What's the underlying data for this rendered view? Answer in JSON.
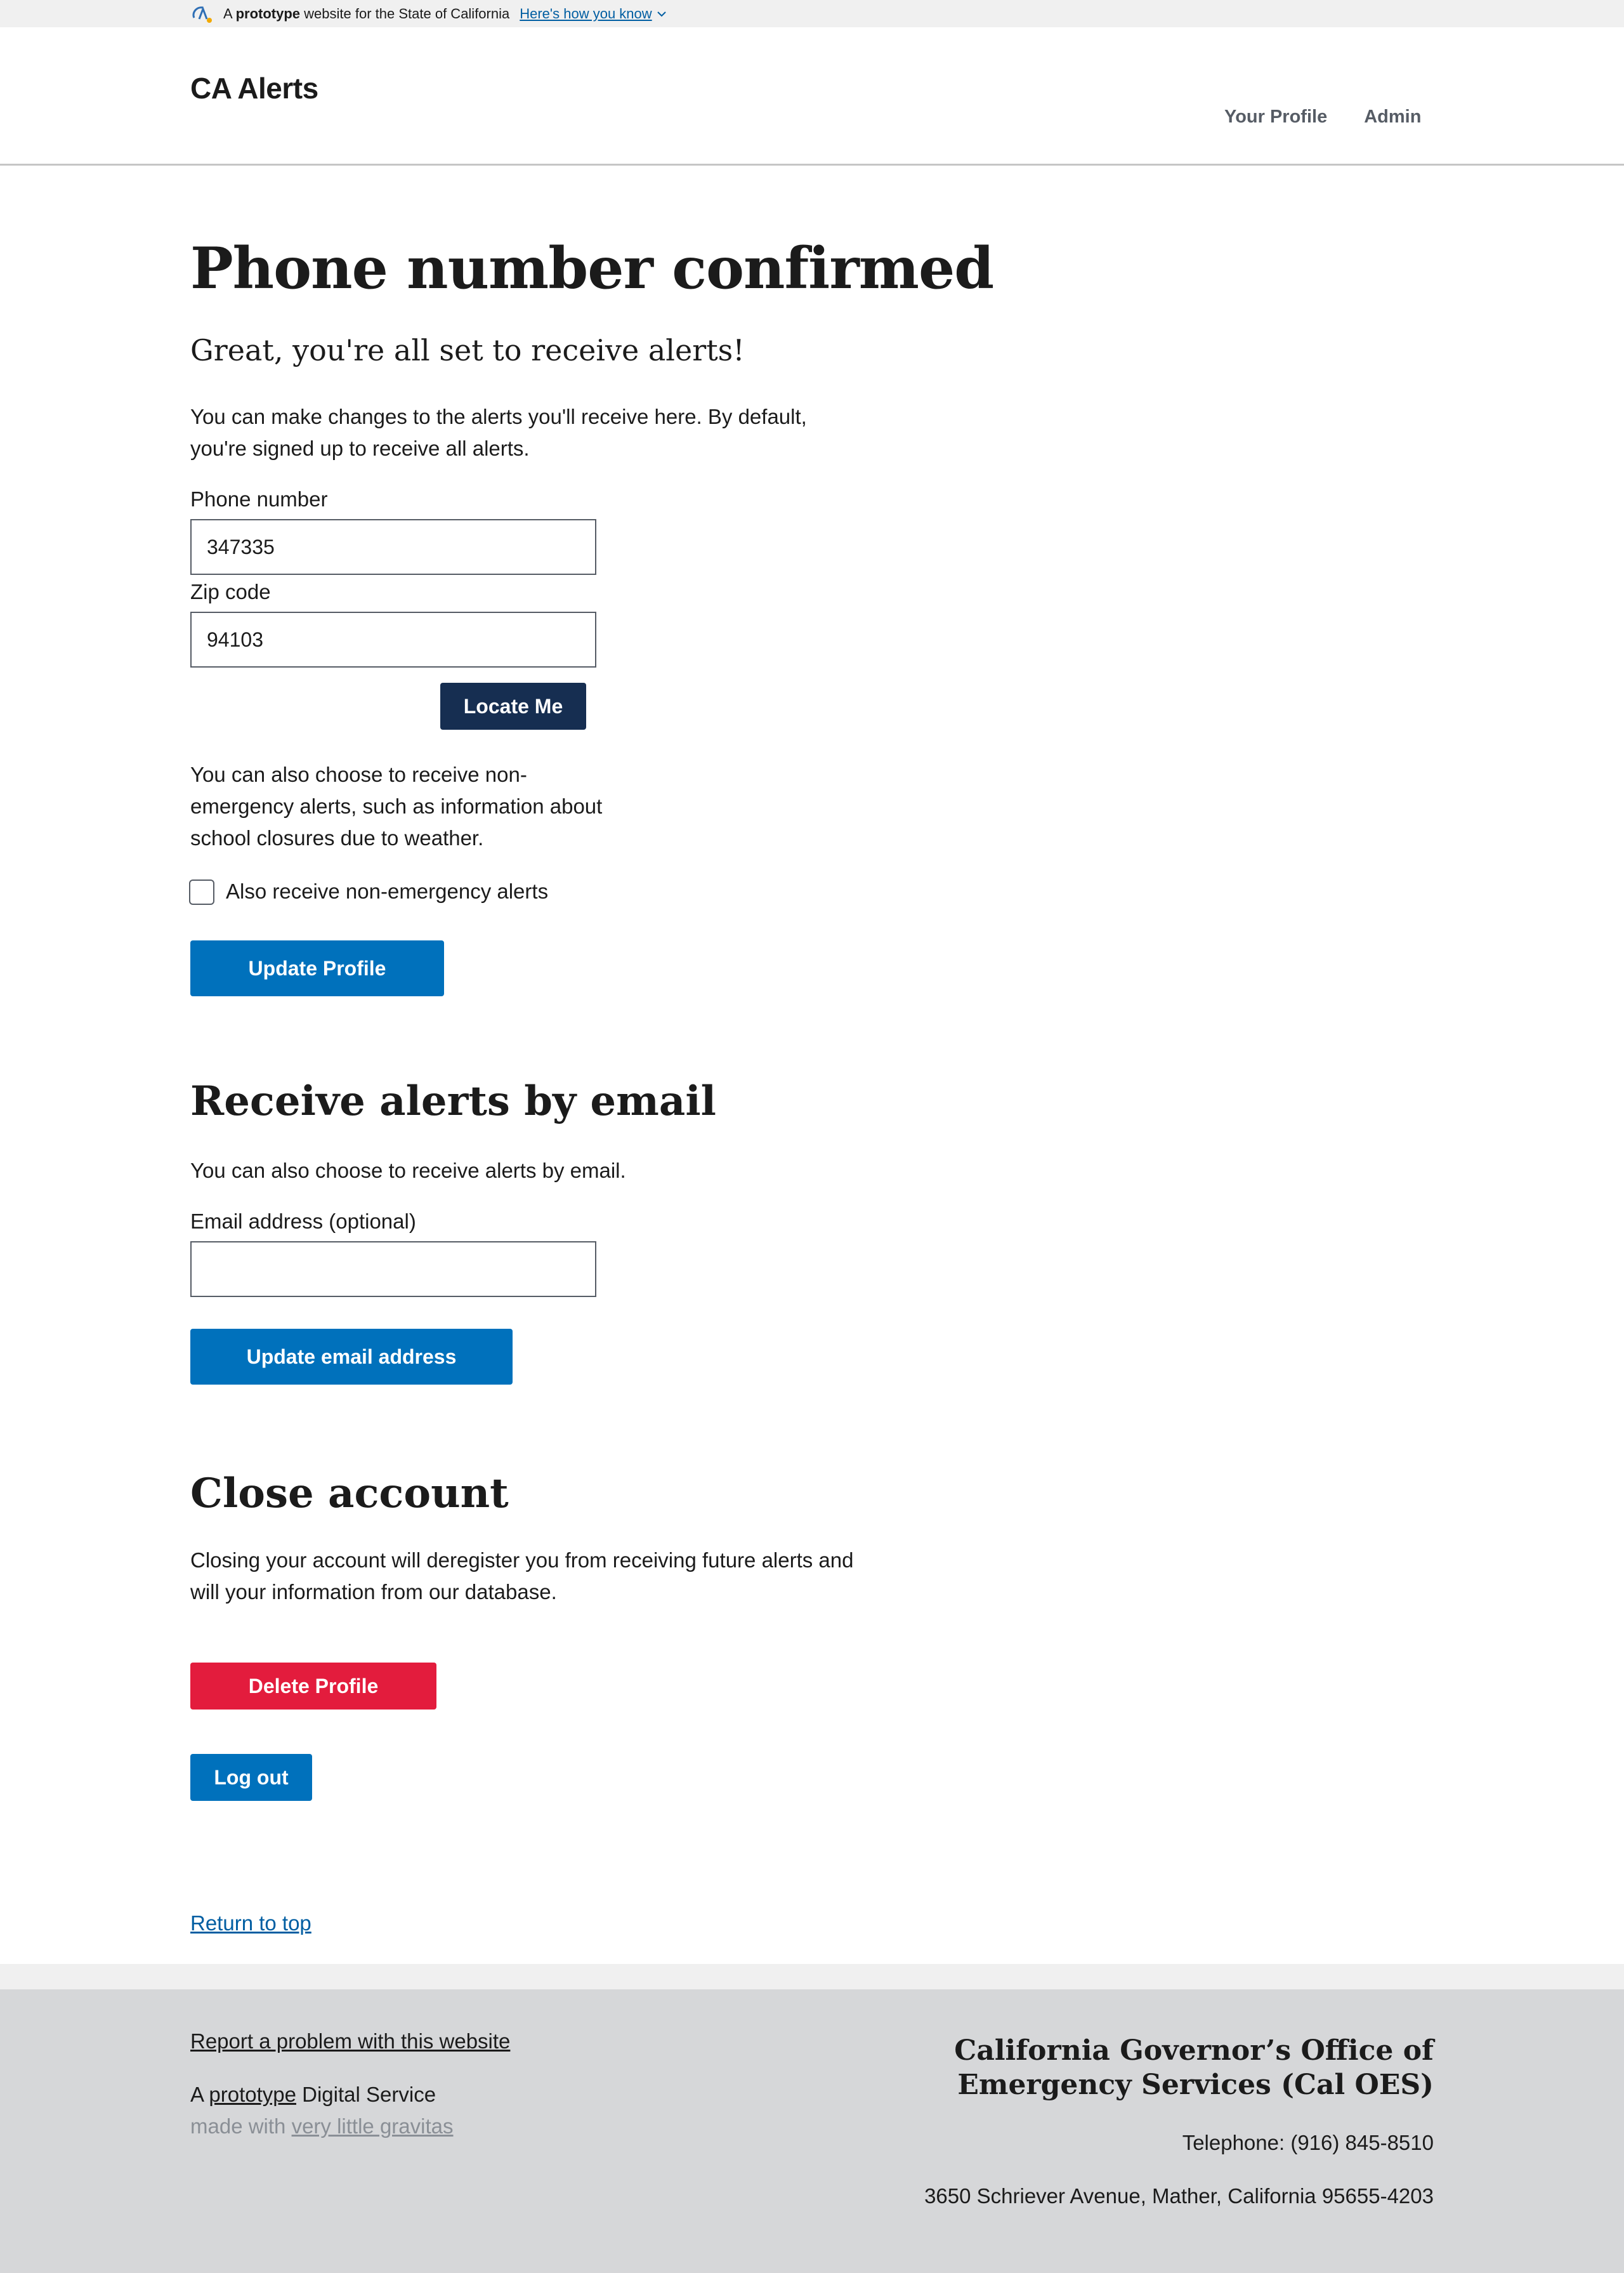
{
  "banner": {
    "prefix": "A",
    "bold": "prototype",
    "suffix": "website for the State of California",
    "link": "Here's how you know"
  },
  "header": {
    "title": "CA Alerts",
    "nav": [
      "Your Profile",
      "Admin"
    ]
  },
  "main": {
    "title": "Phone number confirmed",
    "lead": "Great, you're all set to receive alerts!",
    "intro": "You can make changes to the alerts you'll receive here. By default, you're signed up to receive all alerts.",
    "phone_label": "Phone number",
    "phone_value": "347335",
    "zip_label": "Zip code",
    "zip_value": "94103",
    "locate_button": "Locate Me",
    "nonemergency_text": "You can also choose to receive non-emergency alerts, such as information about school closures due to weather.",
    "nonemergency_checkbox_label": "Also receive non-emergency alerts",
    "nonemergency_checked": false,
    "update_profile_button": "Update Profile"
  },
  "email_section": {
    "title": "Receive alerts by email",
    "text": "You can also choose to receive alerts by email.",
    "email_label": "Email address (optional)",
    "email_value": "",
    "update_email_button": "Update email address"
  },
  "close_section": {
    "title": "Close account",
    "text": "Closing your account will deregister you from receiving future alerts and will your information from our database.",
    "delete_button": "Delete Profile",
    "logout_button": "Log out"
  },
  "return_to_top": "Return to top",
  "footer": {
    "report_link": "Report a problem with this website",
    "digital_service_prefix": "A",
    "digital_service_link": "prototype",
    "digital_service_suffix": "Digital Service",
    "made_with_prefix": "made with",
    "made_with_link": "very little gravitas",
    "org_line1": "California Governor’s Office of",
    "org_line2": "Emergency Services (Cal OES)",
    "telephone": "Telephone: (916) 845-8510",
    "address": "3650 Schriever Avenue, Mather, California 95655-4203"
  },
  "colors": {
    "primary": "#0071bc",
    "dark": "#162e51",
    "danger": "#e31c3d",
    "link": "#005ea2"
  }
}
